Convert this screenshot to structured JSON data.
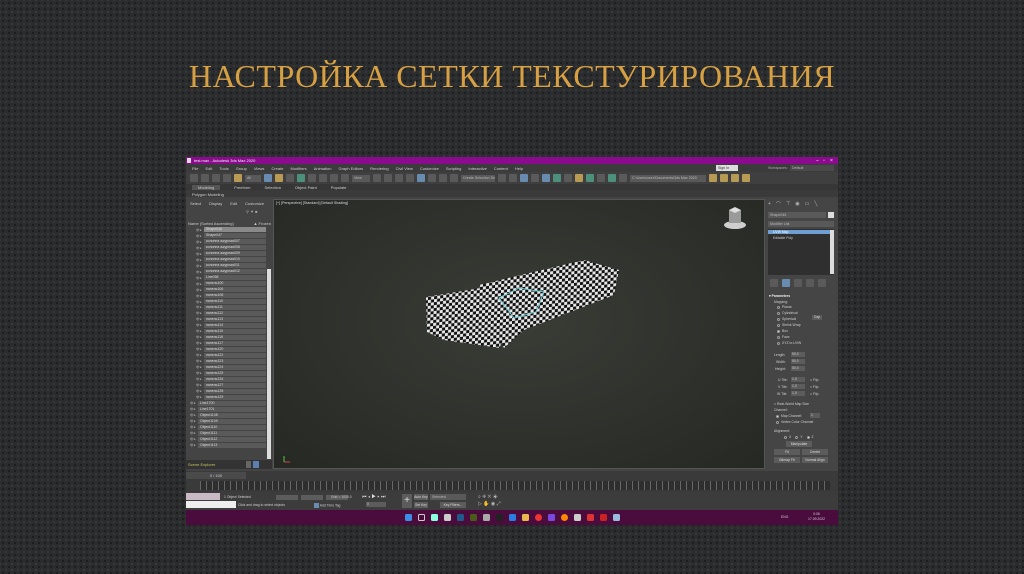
{
  "slide": {
    "title": "НАСТРОЙКА СЕТКИ ТЕКСТУРИРОВАНИЯ"
  },
  "app": {
    "window_title": "test.max - Autodesk 3ds Max 2020",
    "menus": [
      "File",
      "Edit",
      "Tools",
      "Group",
      "Views",
      "Create",
      "Modifiers",
      "Animation",
      "Graph Editors",
      "Rendering",
      "Civil View",
      "Customize",
      "Scripting",
      "Interactive",
      "Content",
      "Help"
    ],
    "toolbar": {
      "filter": "All",
      "ref_coord": "View",
      "selection_set": "Create Selection Se",
      "project_path": "C:\\Users\\user\\Documents\\3ds Max 2020",
      "sign_in": "Sign In",
      "workspaces_label": "Workspaces:",
      "workspace": "Default"
    },
    "ribbon_tabs": [
      "Modeling",
      "Freeform",
      "Selection",
      "Object Paint",
      "Populate"
    ],
    "ribbon_panel": "Polygon Modeling",
    "explorer": {
      "tabs": [
        "Select",
        "Display",
        "Edit",
        "Customize"
      ],
      "sort_header": "Name (Sorted Ascending)",
      "frozen_header": "▲ Frozen",
      "label": "Scene Explorer",
      "items": [
        "Shape046",
        "Shape047",
        "колонна ажурная007",
        "колонна ажурная008",
        "колонна ажурная009",
        "колонна ажурная010",
        "колонна ажурная011",
        "колонна ажурная012",
        "Line058",
        "панель100",
        "панель106",
        "панель108",
        "панель110",
        "панель111",
        "панель112",
        "панель113",
        "панель114",
        "панель115",
        "панель116",
        "панель117",
        "панель120",
        "панель122",
        "панель123",
        "панель124",
        "панель125",
        "панель126",
        "панель127",
        "панель128",
        "панель129",
        "Line1700",
        "Line1701",
        "Object1108",
        "Object1109",
        "Object1110",
        "Object1111",
        "Object1112",
        "Object1113"
      ]
    },
    "viewport": {
      "label": "[+] [Perspective] [Standard] [Default Shading]"
    },
    "command_panel": {
      "object_name": "Shape046",
      "modifier_list": "Modifier List",
      "stack": [
        "UVW Map",
        "Editable Poly"
      ],
      "rollout": "Parameters",
      "mapping_label": "Mapping:",
      "mapping": [
        "Planar",
        "Cylindrical",
        "Spherical",
        "Shrink Wrap",
        "Box",
        "Face",
        "XYZ to UVW"
      ],
      "mapping_selected": "Box",
      "cap": "Cap",
      "length_label": "Length:",
      "length": "50,0",
      "width_label": "Width:",
      "width": "50,0",
      "height_label": "Height:",
      "height": "50,0",
      "u_tile_label": "U Tile:",
      "u_tile": "1,0",
      "v_tile_label": "V Tile:",
      "v_tile": "1,0",
      "w_tile_label": "W Tile:",
      "w_tile": "1,0",
      "flip": "Flip",
      "real_world": "Real-World Map Size",
      "channel_label": "Channel:",
      "map_channel": "Map Channel:",
      "map_channel_value": "1",
      "vertex_color": "Vertex Color Channel",
      "alignment_label": "Alignment:",
      "axes": [
        "X",
        "Y",
        "Z"
      ],
      "manipulate": "Manipulate",
      "fit": "Fit",
      "center": "Center",
      "bitmap_fit": "Bitmap Fit",
      "normal_align": "Normal Align"
    },
    "timeline": {
      "frame": "0 / 100"
    },
    "status": {
      "selected": "1 Object Selected",
      "prompt": "Click and drag to select objects",
      "grid": "Grid = 1000,0",
      "add_time_tag": "Add Time Tag",
      "auto_key": "Auto Key",
      "set_key": "Set Key",
      "selected_set": "Selected",
      "key_filters": "Key Filters...",
      "frame_field": "0"
    },
    "taskbar": {
      "lang": "ENG",
      "time": "0:06",
      "date": "17.09.2022"
    }
  },
  "colors": {
    "title": "#d6a043",
    "titlebar": "#8a0b8e",
    "taskbar": "#4a0b3d"
  }
}
